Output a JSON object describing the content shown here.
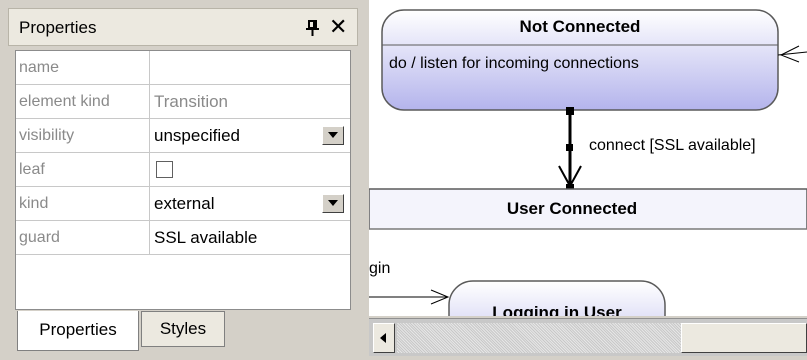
{
  "properties_panel": {
    "title": "Properties",
    "rows": [
      {
        "name": "name",
        "value": ""
      },
      {
        "name": "element kind",
        "value": "Transition"
      },
      {
        "name": "visibility",
        "value": "unspecified"
      },
      {
        "name": "leaf",
        "value": ""
      },
      {
        "name": "kind",
        "value": "external"
      },
      {
        "name": "guard",
        "value": "SSL available"
      }
    ],
    "tabs": [
      "Properties",
      "Styles"
    ]
  },
  "diagram": {
    "state_not_connected": {
      "title": "Not Connected",
      "activity": "do / listen for incoming connections"
    },
    "transition_label": "connect [SSL available]",
    "composite_state": {
      "title": "User Connected"
    },
    "sub_state": {
      "title": "Logging in User"
    },
    "partial_label": "gin"
  },
  "colors": {
    "state_fill_top": "#ffffff",
    "state_fill_bottom": "#b8b8ee",
    "state_border": "#5a5a5a",
    "panel_bg": "#d4d0c8"
  }
}
